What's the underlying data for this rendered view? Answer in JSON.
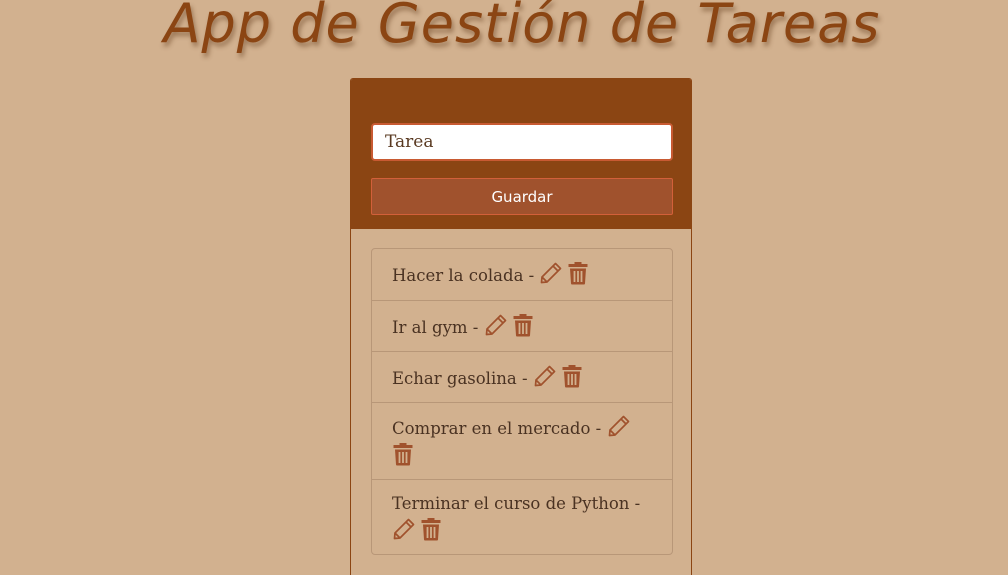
{
  "header": {
    "title": "App de Gestión de Tareas"
  },
  "form": {
    "task_value": "Tarea",
    "save_label": "Guardar"
  },
  "tasks": [
    {
      "label": "Hacer la colada -"
    },
    {
      "label": "Ir al gym -"
    },
    {
      "label": "Echar gasolina -"
    },
    {
      "label": "Comprar en el mercado -"
    },
    {
      "label": "Terminar el curso de Python -"
    }
  ],
  "icons": {
    "edit": "pencil-icon",
    "delete": "trash-icon"
  },
  "colors": {
    "background": "#d2b18f",
    "header": "#8b4513",
    "button": "#a0522d",
    "icon": "#a0522d",
    "title": "#8b4513"
  }
}
